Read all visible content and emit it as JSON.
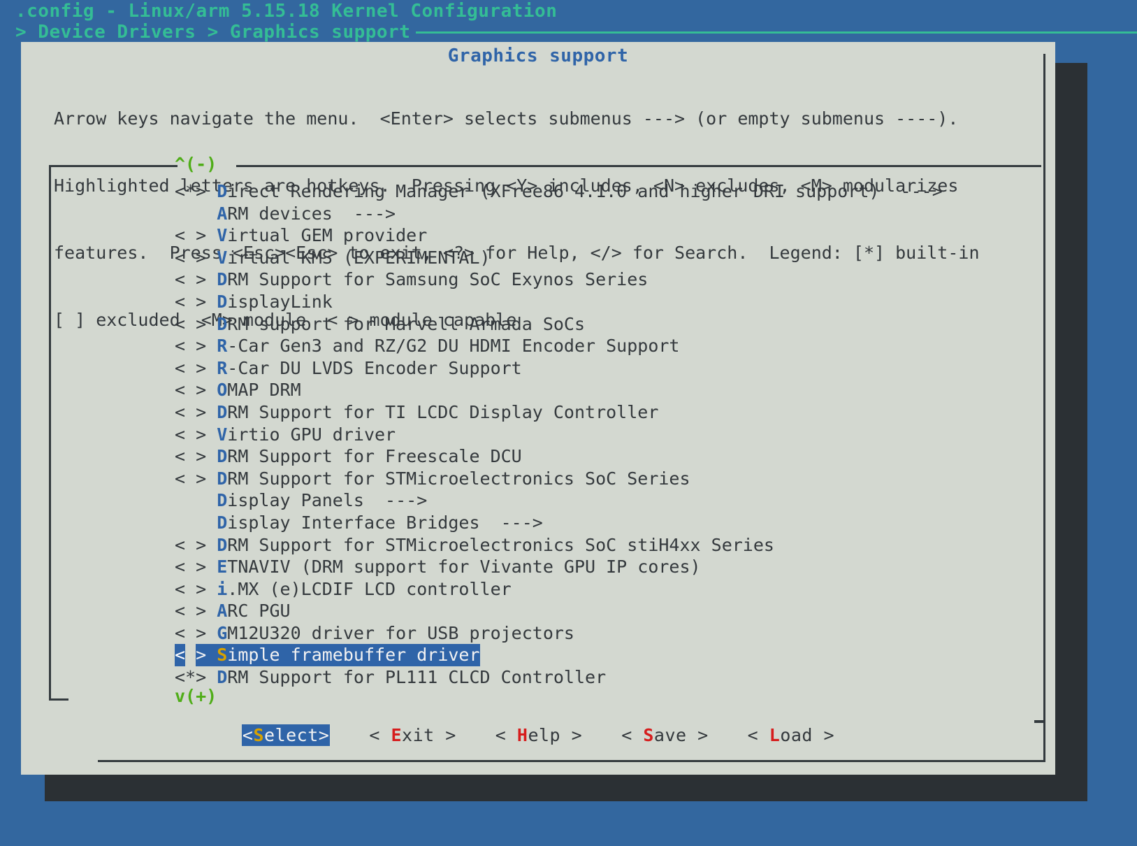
{
  "terminal": {
    "title_line_1": ".config - Linux/arm 5.15.18 Kernel Configuration",
    "breadcrumb": "> Device Drivers > Graphics support",
    "bg_color": "#33679f",
    "title_color": "#34bd95"
  },
  "dialog": {
    "title": "Graphics support",
    "title_color": "#2f64a8",
    "bg_color": "#d3d8d0",
    "border_color": "#333a3e",
    "shadow_color": "#2b3034",
    "help_lines": [
      "Arrow keys navigate the menu.  <Enter> selects submenus ---> (or empty submenus ----).",
      "Highlighted letters are hotkeys.  Pressing <Y> includes, <N> excludes, <M> modularizes",
      "features.  Press <Esc><Esc> to exit, <?> for Help, </> for Search.  Legend: [*] built-in",
      "[ ] excluded  <M> module  < > module capable"
    ]
  },
  "scroll": {
    "up_marker": "^(-)",
    "down_marker": "v(+)",
    "marker_color": "#4fad18"
  },
  "menu": {
    "hotkey_color": "#2f64a8",
    "selected_bg": "#2f64a8",
    "selected_fg": "#f2f2f2",
    "selected_hotkey_color": "#d8a200",
    "items": [
      {
        "prefix": "<*> ",
        "hotkey": "D",
        "rest": "irect Rendering Manager (XFree86 4.1.0 and higher DRI support)  --->",
        "selected": false
      },
      {
        "prefix": "    ",
        "hotkey": "A",
        "rest": "RM devices  --->",
        "selected": false
      },
      {
        "prefix": "< > ",
        "hotkey": "V",
        "rest": "irtual GEM provider",
        "selected": false
      },
      {
        "prefix": "< > ",
        "hotkey": "V",
        "rest": "irtual KMS (EXPERIMENTAL)",
        "selected": false
      },
      {
        "prefix": "< > ",
        "hotkey": "D",
        "rest": "RM Support for Samsung SoC Exynos Series",
        "selected": false
      },
      {
        "prefix": "< > ",
        "hotkey": "D",
        "rest": "isplayLink",
        "selected": false
      },
      {
        "prefix": "< > ",
        "hotkey": "D",
        "rest": "RM support for Marvell Armada SoCs",
        "selected": false
      },
      {
        "prefix": "< > ",
        "hotkey": "R",
        "rest": "-Car Gen3 and RZ/G2 DU HDMI Encoder Support",
        "selected": false
      },
      {
        "prefix": "< > ",
        "hotkey": "R",
        "rest": "-Car DU LVDS Encoder Support",
        "selected": false
      },
      {
        "prefix": "< > ",
        "hotkey": "O",
        "rest": "MAP DRM",
        "selected": false
      },
      {
        "prefix": "< > ",
        "hotkey": "D",
        "rest": "RM Support for TI LCDC Display Controller",
        "selected": false
      },
      {
        "prefix": "< > ",
        "hotkey": "V",
        "rest": "irtio GPU driver",
        "selected": false
      },
      {
        "prefix": "< > ",
        "hotkey": "D",
        "rest": "RM Support for Freescale DCU",
        "selected": false
      },
      {
        "prefix": "< > ",
        "hotkey": "D",
        "rest": "RM Support for STMicroelectronics SoC Series",
        "selected": false
      },
      {
        "prefix": "    ",
        "hotkey": "D",
        "rest": "isplay Panels  --->",
        "selected": false
      },
      {
        "prefix": "    ",
        "hotkey": "D",
        "rest": "isplay Interface Bridges  --->",
        "selected": false
      },
      {
        "prefix": "< > ",
        "hotkey": "D",
        "rest": "RM Support for STMicroelectronics SoC stiH4xx Series",
        "selected": false
      },
      {
        "prefix": "< > ",
        "hotkey": "E",
        "rest": "TNAVIV (DRM support for Vivante GPU IP cores)",
        "selected": false
      },
      {
        "prefix": "< > ",
        "hotkey": "i",
        "rest": ".MX (e)LCDIF LCD controller",
        "selected": false
      },
      {
        "prefix": "< > ",
        "hotkey": "A",
        "rest": "RC PGU",
        "selected": false
      },
      {
        "prefix": "< > ",
        "hotkey": "G",
        "rest": "M12U320 driver for USB projectors",
        "selected": false
      },
      {
        "prefix": "< > ",
        "hotkey": "S",
        "rest": "imple framebuffer driver",
        "selected": true
      },
      {
        "prefix": "<*> ",
        "hotkey": "D",
        "rest": "RM Support for PL111 CLCD Controller",
        "selected": false
      }
    ]
  },
  "buttons": [
    {
      "left": "<",
      "hotkey": "S",
      "rest": "elect",
      "right": ">",
      "active": true
    },
    {
      "left": "< ",
      "hotkey": "E",
      "rest": "xit",
      "right": " >",
      "active": false
    },
    {
      "left": "< ",
      "hotkey": "H",
      "rest": "elp",
      "right": " >",
      "active": false
    },
    {
      "left": "< ",
      "hotkey": "S",
      "rest": "ave",
      "right": " >",
      "active": false
    },
    {
      "left": "< ",
      "hotkey": "L",
      "rest": "oad",
      "right": " >",
      "active": false
    }
  ]
}
